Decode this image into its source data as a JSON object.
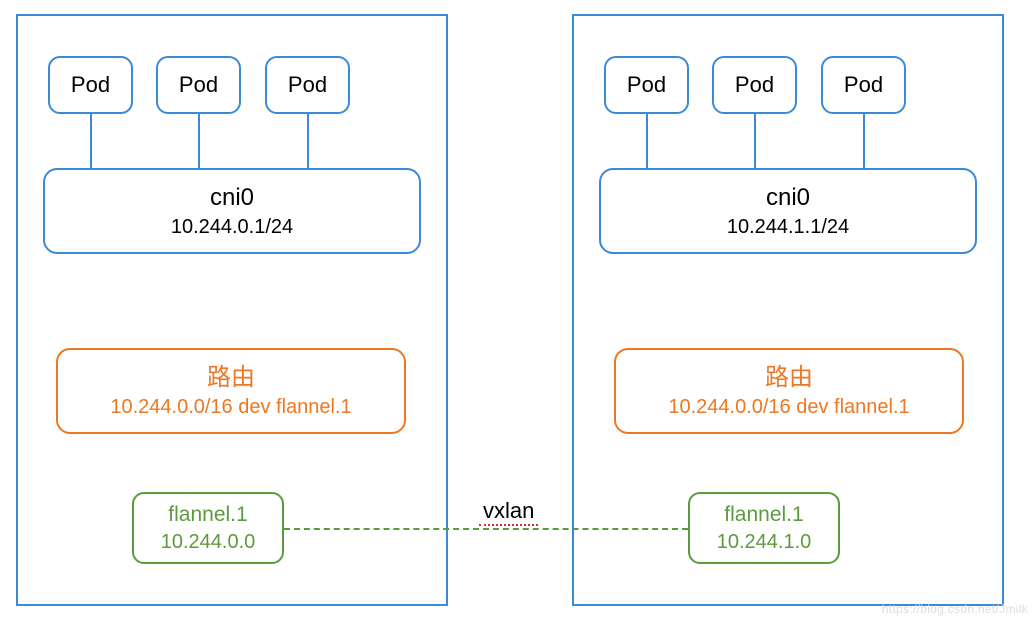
{
  "left": {
    "pods": [
      "Pod",
      "Pod",
      "Pod"
    ],
    "cni": {
      "name": "cni0",
      "cidr": "10.244.0.1/24"
    },
    "route": {
      "title": "路由",
      "detail": "10.244.0.0/16 dev flannel.1"
    },
    "flannel": {
      "name": "flannel.1",
      "ip": "10.244.0.0"
    }
  },
  "right": {
    "pods": [
      "Pod",
      "Pod",
      "Pod"
    ],
    "cni": {
      "name": "cni0",
      "cidr": "10.244.1.1/24"
    },
    "route": {
      "title": "路由",
      "detail": "10.244.0.0/16 dev flannel.1"
    },
    "flannel": {
      "name": "flannel.1",
      "ip": "10.244.1.0"
    }
  },
  "tunnel": {
    "protocol": "vxlan"
  },
  "watermark": "https://blog.csdn.net/Jmilk"
}
